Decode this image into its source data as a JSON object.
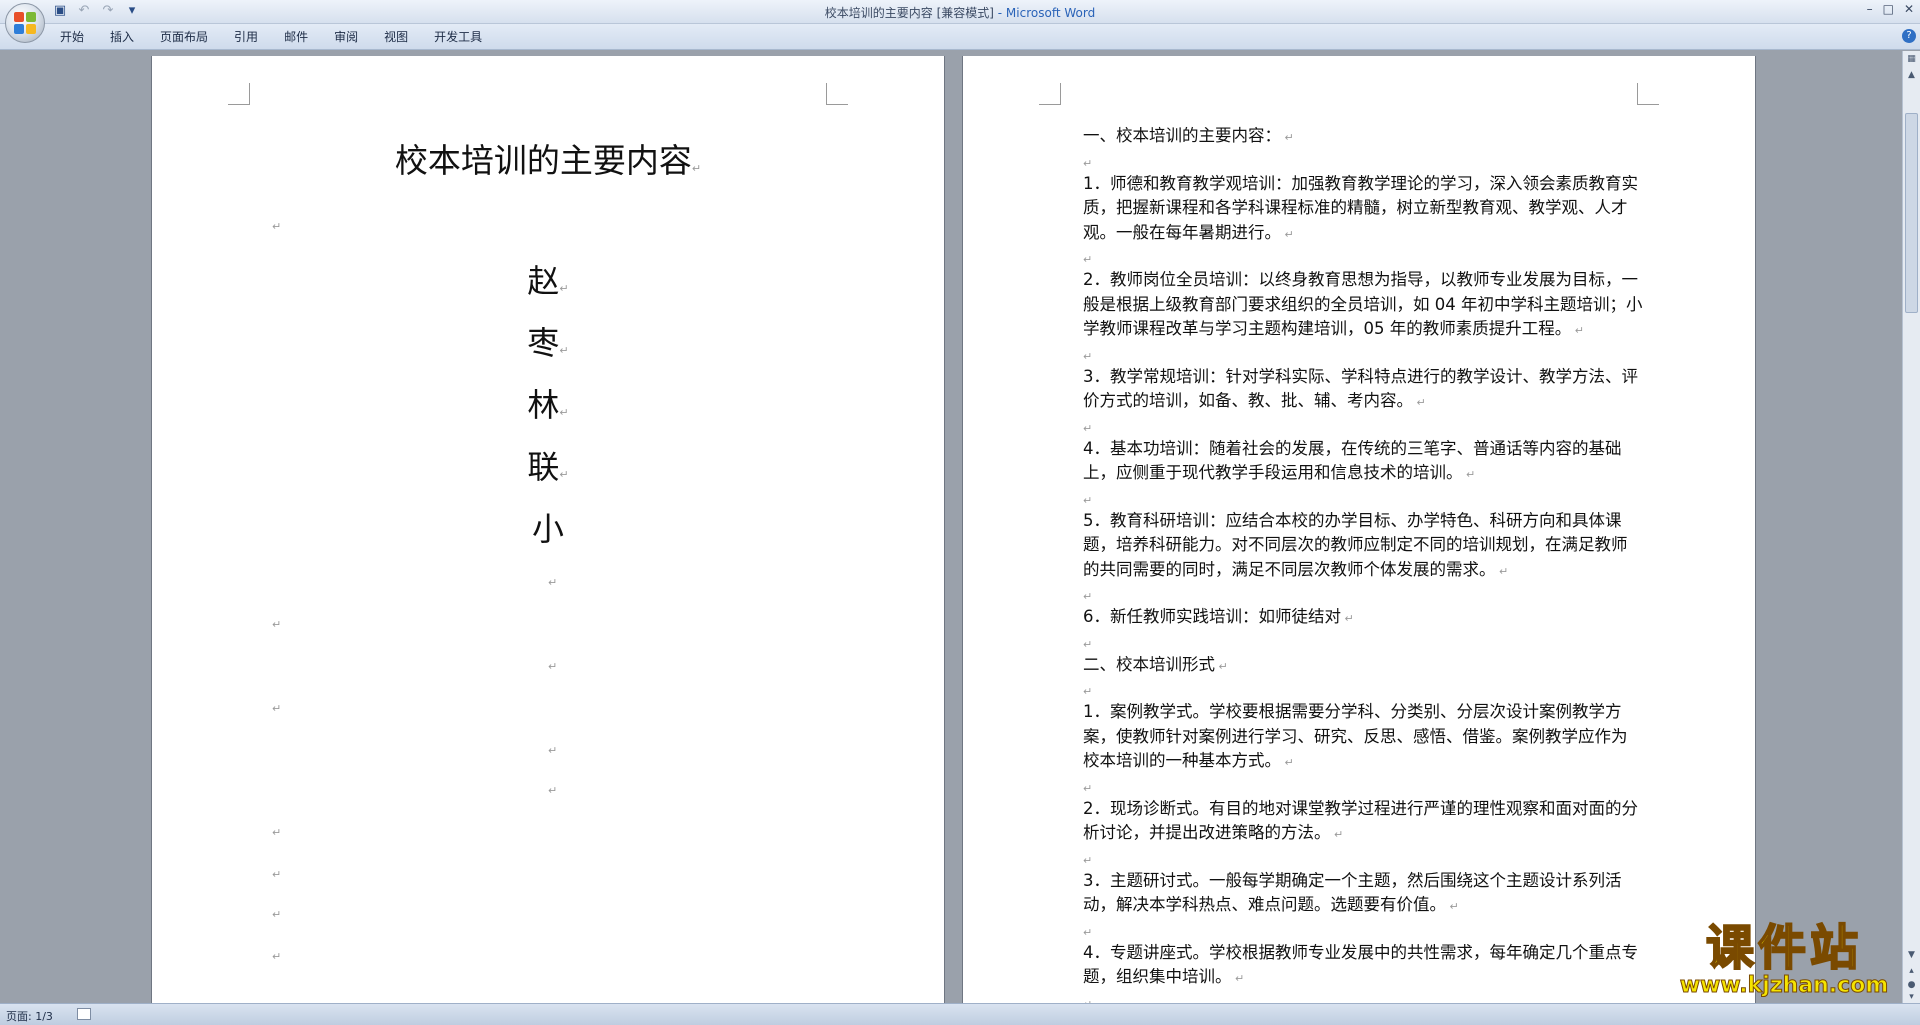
{
  "window": {
    "doc_title": "校本培训的主要内容 [兼容模式]",
    "app_suffix": " - Microsoft Word",
    "controls": [
      "–",
      "□",
      "✕"
    ]
  },
  "quick_access": [
    "save-icon",
    "undo-icon",
    "redo-icon",
    "customize-icon"
  ],
  "ribbon_tabs": [
    "开始",
    "插入",
    "页面布局",
    "引用",
    "邮件",
    "审阅",
    "视图",
    "开发工具"
  ],
  "left_page": {
    "title": "校本培训的主要内容",
    "author_chars": [
      "赵",
      "枣",
      "林",
      "联",
      "小"
    ],
    "para_mark": "↵"
  },
  "right_page": {
    "paragraphs": [
      "一、校本培训的主要内容：",
      "",
      "1．师德和教育教学观培训：加强教育教学理论的学习，深入领会素质教育实质，把握新课程和各学科课程标准的精髓，树立新型教育观、教学观、人才观。一般在每年暑期进行。",
      "",
      "2．教师岗位全员培训：以终身教育思想为指导，以教师专业发展为目标，一般是根据上级教育部门要求组织的全员培训，如 04 年初中学科主题培训；小学教师课程改革与学习主题构建培训，05 年的教师素质提升工程。",
      "",
      "3．教学常规培训：针对学科实际、学科特点进行的教学设计、教学方法、评价方式的培训，如备、教、批、辅、考内容。",
      "",
      "4．基本功培训：随着社会的发展，在传统的三笔字、普通话等内容的基础上，应侧重于现代教学手段运用和信息技术的培训。",
      "",
      "5．教育科研培训：应结合本校的办学目标、办学特色、科研方向和具体课题，培养科研能力。对不同层次的教师应制定不同的培训规划，在满足教师的共同需要的同时，满足不同层次教师个体发展的需求。",
      "",
      "6．新任教师实践培训：如师徒结对",
      "",
      "二、校本培训形式",
      "",
      "1．案例教学式。学校要根据需要分学科、分类别、分层次设计案例教学方案，使教师针对案例进行学习、研究、反思、感悟、借鉴。案例教学应作为校本培训的一种基本方式。",
      "",
      "2．现场诊断式。有目的地对课堂教学过程进行严谨的理性观察和面对面的分析讨论，并提出改进策略的方法。",
      "",
      "3．主题研讨式。一般每学期确定一个主题，然后围绕这个主题设计系列活动，解决本学科热点、难点问题。选题要有价值。",
      "",
      "4．专题讲座式。学校根据教师专业发展中的共性需求，每年确定几个重点专题，组织集中培训。",
      ""
    ]
  },
  "status": {
    "page_info": "页面: 1/3"
  },
  "watermark": {
    "title": "课件站",
    "url": "www.kjzhan.com"
  }
}
